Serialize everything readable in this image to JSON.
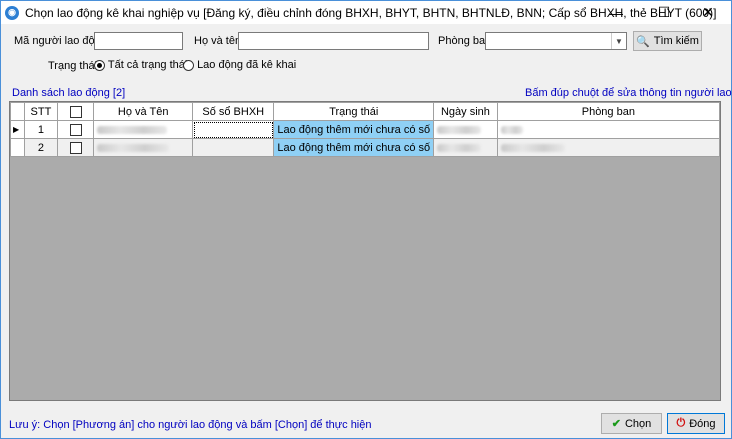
{
  "window": {
    "title": "Chọn lao động kê khai nghiệp vụ [Đăng ký, điều chỉnh đóng BHXH, BHYT, BHTN, BHTNLĐ, BNN; Cấp sổ BHXH, thẻ BHYT (600)]",
    "icon": "app-logo-icon",
    "minimize_glyph": "—",
    "maximize_glyph": "☐",
    "close_glyph": "✕"
  },
  "filters": {
    "employee_code_label": "Mã người lao động:",
    "employee_code_value": "",
    "name_label": "Họ và tên:",
    "name_value": "",
    "department_label": "Phòng ban:",
    "department_value": "",
    "search_button": "Tìm kiếm",
    "status_label": "Trạng thái:",
    "status_options": [
      {
        "label": "Tất cả trạng thái",
        "selected": true
      },
      {
        "label": "Lao động đã kê khai",
        "selected": false
      }
    ]
  },
  "list": {
    "title": "Danh sách lao động [2]",
    "hint": "Bấm đúp chuột để sửa thông tin người lao động",
    "columns": [
      "STT",
      "",
      "Họ và Tên",
      "Số sổ BHXH",
      "Trạng thái",
      "Ngày sinh",
      "Phòng ban"
    ],
    "rows": [
      {
        "stt": "1",
        "checked": false,
        "name": "",
        "bhxh_no": "",
        "status": "Lao động thêm mới chưa có số",
        "dob": "",
        "department": ""
      },
      {
        "stt": "2",
        "checked": false,
        "name": "",
        "bhxh_no": "",
        "status": "Lao động thêm mới chưa có số",
        "dob": "",
        "department": ""
      }
    ]
  },
  "footer": {
    "note": "Lưu ý: Chọn [Phương án] cho người lao động và bấm [Chọn] để thực hiện",
    "choose_button": "Chọn",
    "close_button": "Đóng",
    "accent_check": "#1a9a1a",
    "accent_close": "#d01010"
  }
}
